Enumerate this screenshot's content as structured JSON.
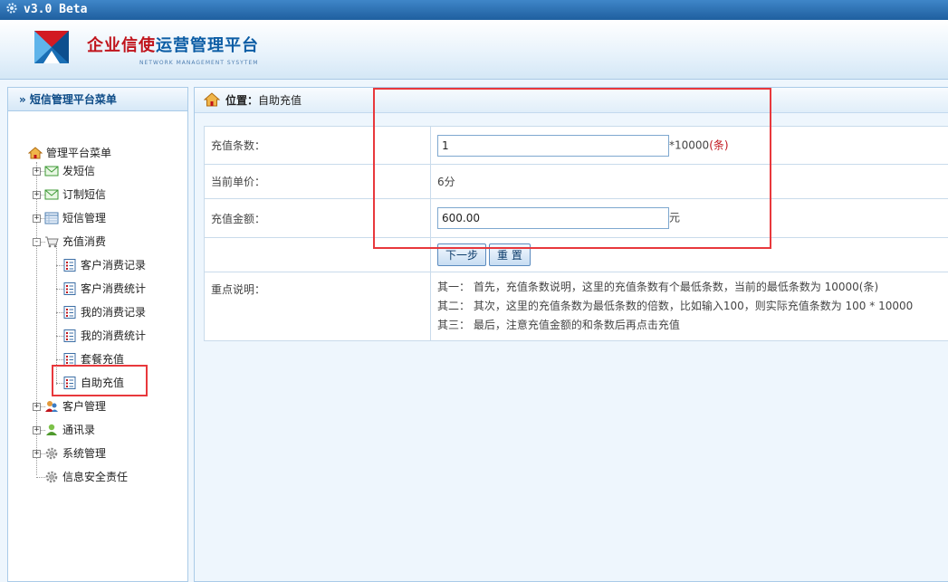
{
  "app": {
    "title": "v3.0 Beta"
  },
  "brand": {
    "name_red": "企业信使",
    "name_blue": "运营管理平台",
    "subtitle": "NETWORK  MANAGEMENT SYSYTEM"
  },
  "sidebar": {
    "header": "» 短信管理平台菜单",
    "root": "管理平台菜单",
    "items": [
      {
        "label": "发短信",
        "expand": "+",
        "icon": "envelope-icon"
      },
      {
        "label": "订制短信",
        "expand": "+",
        "icon": "envelope-icon"
      },
      {
        "label": "短信管理",
        "expand": "+",
        "icon": "table-icon"
      },
      {
        "label": "充值消费",
        "expand": "-",
        "icon": "cart-icon"
      },
      {
        "label": "客户管理",
        "expand": "+",
        "icon": "users-icon"
      },
      {
        "label": "通讯录",
        "expand": "+",
        "icon": "contact-icon"
      },
      {
        "label": "系统管理",
        "expand": "+",
        "icon": "gear-icon"
      },
      {
        "label": "信息安全责任",
        "icon": "gear-icon"
      }
    ],
    "children": [
      {
        "label": "客户消费记录"
      },
      {
        "label": "客户消费统计"
      },
      {
        "label": "我的消费记录"
      },
      {
        "label": "我的消费统计"
      },
      {
        "label": "套餐充值"
      },
      {
        "label": "自助充值"
      }
    ]
  },
  "breadcrumb": {
    "prefix": "位置：",
    "page": "自助充值"
  },
  "form": {
    "count_label": "充值条数：",
    "count_value": "1",
    "count_suffix": "*10000",
    "count_unit": "(条)",
    "price_label": "当前单价：",
    "price_value": "6分",
    "amount_label": "充值金额：",
    "amount_value": "600.00",
    "amount_unit": "元",
    "next_button": "下一步",
    "reset_button": "重 置",
    "notes_label": "重点说明：",
    "notes": [
      "其一： 首先，充值条数说明，这里的充值条数有个最低条数，当前的最低条数为 10000(条)",
      "其二： 其次，这里的充值条数为最低条数的倍数，比如输入100，则实际充值条数为 100 * 10000",
      "其三： 最后，注意充值金额的和条数后再点击充值"
    ]
  },
  "colors": {
    "highlight": "#e8383c",
    "accent": "#1f5f9f",
    "unit_red": "#c0141c"
  }
}
